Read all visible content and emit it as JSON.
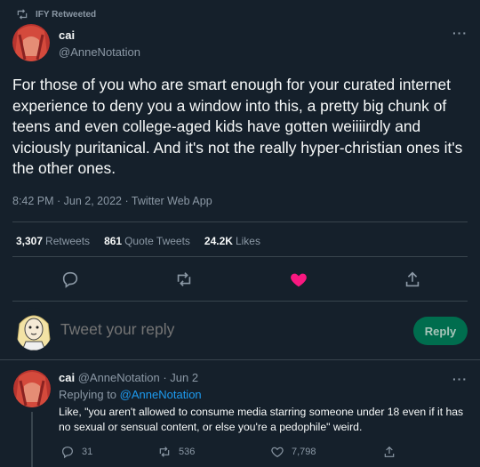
{
  "retweeted_by": "IFY Retweeted",
  "tweet": {
    "display_name": "cai",
    "handle": "@AnneNotation",
    "text": "For those of you who are smart enough for your curated internet experience to deny you a window into this, a pretty big chunk of teens and even college-aged kids have gotten weiiiirdly and viciously puritanical. And it's not the really hyper-christian ones it's the other ones.",
    "timestamp": "8:42 PM · Jun 2, 2022 · Twitter Web App",
    "stats": {
      "retweets_count": "3,307",
      "retweets_label": "Retweets",
      "quotes_count": "861",
      "quotes_label": "Quote Tweets",
      "likes_count": "24.2K",
      "likes_label": "Likes"
    }
  },
  "composer": {
    "placeholder": "Tweet your reply",
    "button_label": "Reply"
  },
  "reply": {
    "display_name": "cai",
    "handle": "@AnneNotation",
    "date": "· Jun 2",
    "replying_prefix": "Replying to",
    "replying_to": "@AnneNotation",
    "text": "Like, \"you aren't allowed to consume media starring someone under 18 even if it has no sexual or sensual content, or else you're a pedophile\" weird.",
    "replies": "31",
    "retweets": "536",
    "likes": "7,798"
  },
  "colors": {
    "background": "#15202b",
    "muted": "#8b98a5",
    "link": "#1d9bf0",
    "like": "#f91880",
    "reply_button": "#006d4e"
  },
  "icons": [
    "retweet-icon",
    "more-icon",
    "reply-icon",
    "retweet-icon",
    "heart-icon",
    "share-icon"
  ]
}
